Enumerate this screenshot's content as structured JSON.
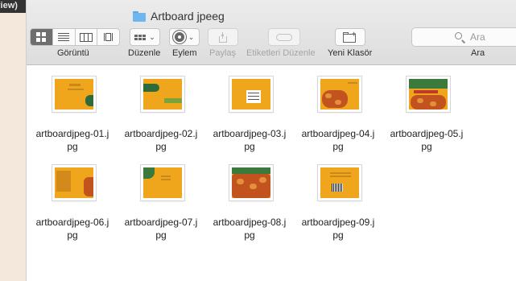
{
  "background_window": {
    "title_fragment": "review)"
  },
  "window": {
    "title": "Artboard jpeeg"
  },
  "toolbar": {
    "view_label": "Görüntü",
    "arrange_label": "Düzenle",
    "action_label": "Eylem",
    "share_label": "Paylaş",
    "tags_label": "Etiketleri Düzenle",
    "new_folder_label": "Yeni Klasör",
    "search_label": "Ara",
    "search_placeholder": "Ara"
  },
  "files": [
    {
      "name_line1": "artboardjpeg-01.j",
      "name_line2": "pg"
    },
    {
      "name_line1": "artboardjpeg-02.j",
      "name_line2": "pg"
    },
    {
      "name_line1": "artboardjpeg-03.j",
      "name_line2": "pg"
    },
    {
      "name_line1": "artboardjpeg-04.j",
      "name_line2": "pg"
    },
    {
      "name_line1": "artboardjpeg-05.j",
      "name_line2": "pg"
    },
    {
      "name_line1": "artboardjpeg-06.j",
      "name_line2": "pg"
    },
    {
      "name_line1": "artboardjpeg-07.j",
      "name_line2": "pg"
    },
    {
      "name_line1": "artboardjpeg-08.j",
      "name_line2": "pg"
    },
    {
      "name_line1": "artboardjpeg-09.j",
      "name_line2": "pg"
    }
  ],
  "colors": {
    "thumbnail_orange": "#f0a61c",
    "folder_blue": "#6db6ef",
    "active_segment": "#6e6e6e"
  }
}
